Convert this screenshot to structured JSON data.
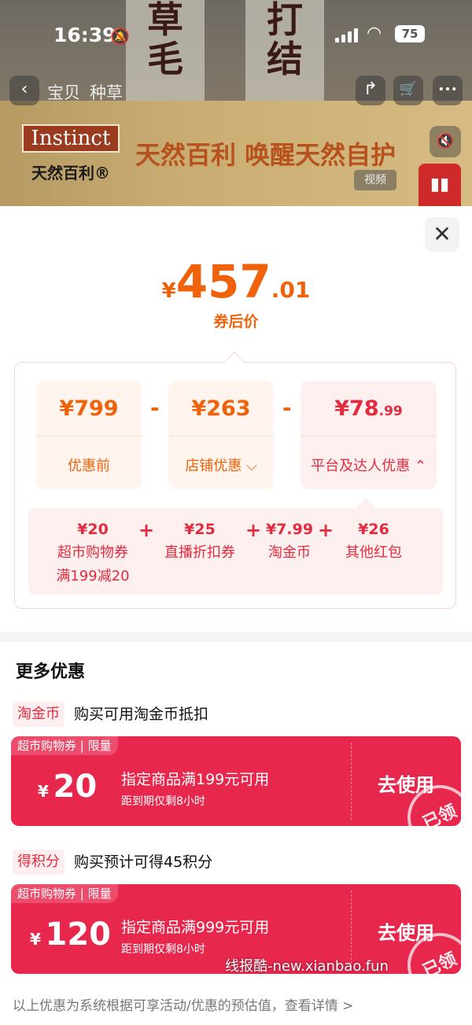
{
  "status_bar": {
    "time": "16:39",
    "battery": "75"
  },
  "nav": {
    "tab_items": "宝贝",
    "tab_seeding": "种草",
    "back_glyph": "‹",
    "share_glyph": "↱",
    "cart_glyph": "🛒",
    "more_glyph": "•••"
  },
  "background": {
    "sign1": [
      "草",
      "毛"
    ],
    "sign2": [
      "打",
      "结"
    ],
    "logo_text": "Instinct",
    "logo_cn": "天然百利®",
    "slogan": "天然百利 唤醒天然自护",
    "video_tag": "视频"
  },
  "sheet": {
    "close_glyph": "✕",
    "final_price": {
      "currency": "¥",
      "integer": "457",
      "decimal": ".01",
      "label": "券后价"
    },
    "breakdown": [
      {
        "amount": "¥799",
        "label": "优惠前"
      },
      {
        "amount": "¥263",
        "label": "店铺优惠 ⌵"
      },
      {
        "amount": "¥78",
        "amount_dec": ".99",
        "label": "平台及达人优惠 ⌃"
      }
    ],
    "operator": "-",
    "plus": "+",
    "platform_items": [
      {
        "value": "¥20",
        "name": "超市购物券",
        "note": "满199减20"
      },
      {
        "value": "¥25",
        "name": "直播折扣券"
      },
      {
        "value": "¥7.99",
        "name": "淘金币"
      },
      {
        "value": "¥26",
        "name": "其他红包"
      }
    ],
    "more_title": "更多优惠",
    "rows": [
      {
        "tag": "淘金币",
        "text": "购买可用淘金币抵扣",
        "coupon": {
          "caption": "超市购物券 | 限量",
          "currency": "¥",
          "amount": "20",
          "condition": "指定商品满199元可用",
          "expiry": "距到期仅剩8小时",
          "action": "去使用",
          "stamp": "已领"
        }
      },
      {
        "tag": "得积分",
        "text": "购买预计可得45积分",
        "coupon": {
          "caption": "超市购物券 | 限量",
          "currency": "¥",
          "amount": "120",
          "condition": "指定商品满999元可用",
          "expiry": "距到期仅剩8小时",
          "action": "去使用",
          "stamp": "已领"
        }
      }
    ],
    "watermark": "线报酷-new.xianbao.fun",
    "footer": "以上优惠为系统根据可享活动/优惠的预估值，查看详情 >"
  },
  "colors": {
    "accent_orange": "#f0620a",
    "accent_red": "#e32b3f",
    "coupon_bg": "#e8274d"
  }
}
